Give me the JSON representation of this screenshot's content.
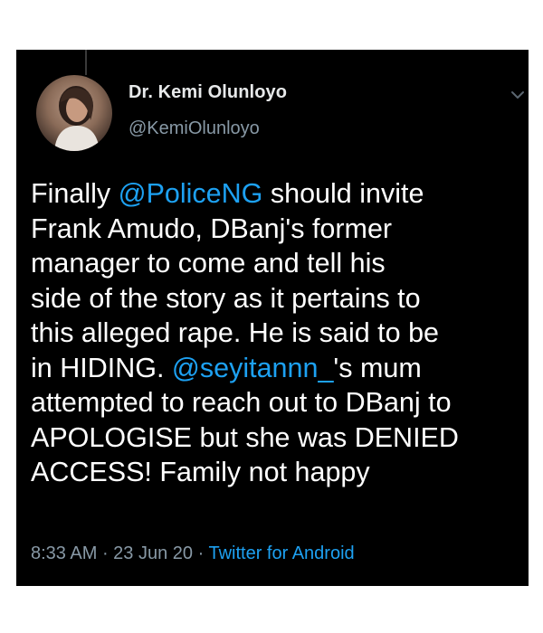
{
  "author": {
    "name": "Dr. Kemi Olunloyo",
    "handle": "@KemiOlunloyo",
    "avatar_icon": "profile-photo"
  },
  "menu_icon": "chevron-down-icon",
  "tweet": {
    "segments": [
      {
        "type": "text",
        "value": "Finally "
      },
      {
        "type": "mention",
        "value": "@PoliceNG"
      },
      {
        "type": "text",
        "value": " should invite\nFrank Amudo, DBanj's former\nmanager to come and tell his\nside of the story as it pertains to\nthis alleged rape. He is said to be\nin HIDING. "
      },
      {
        "type": "mention",
        "value": "@seyitannn_"
      },
      {
        "type": "text",
        "value": "'s mum\nattempted to reach out to DBanj to\nAPOLOGISE but she was DENIED\nACCESS! Family not happy"
      }
    ]
  },
  "meta": {
    "time": "8:33 AM",
    "separator": " · ",
    "date": "23 Jun 20",
    "source": "Twitter for Android"
  },
  "colors": {
    "background": "#000000",
    "text": "#ffffff",
    "link": "#1da1f2",
    "secondary": "#8899a6"
  }
}
